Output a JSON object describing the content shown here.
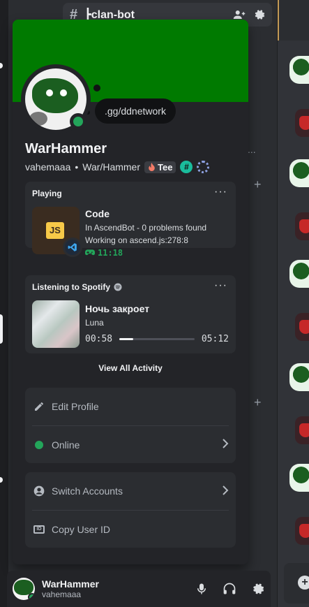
{
  "channel": {
    "hash": "#",
    "name": "┣clan-bot"
  },
  "profile": {
    "display_name": "WarHammer",
    "username": "vahemaaa",
    "separator": "•",
    "pronouns": "War/Hammer",
    "tag": "Tee",
    "status_message": ".gg/ddnetwork",
    "banner_color": "#007a00",
    "status_color": "#23a55a"
  },
  "activity": {
    "heading": "Playing",
    "title": "Code",
    "details": "In AscendBot - 0 problems found",
    "state": "Working on ascend.js:278:8",
    "elapsed": "11:18",
    "app_icon": "js-icon",
    "badge_icon": "vscode-icon"
  },
  "spotify": {
    "heading": "Listening to Spotify",
    "track": "Ночь закроет",
    "artist": "Luna",
    "current": "00:58",
    "total": "05:12",
    "progress": 0.186
  },
  "view_all_label": "View All Activity",
  "menu_profile": {
    "edit_label": "Edit Profile",
    "status_label": "Online"
  },
  "menu_account": {
    "switch_label": "Switch Accounts",
    "copy_id_label": "Copy User ID"
  },
  "user_panel": {
    "name": "WarHammer",
    "username": "vahemaaa"
  },
  "sidebar_dots": "...",
  "plus": "+",
  "js_label": "JS",
  "id_label": "ID"
}
